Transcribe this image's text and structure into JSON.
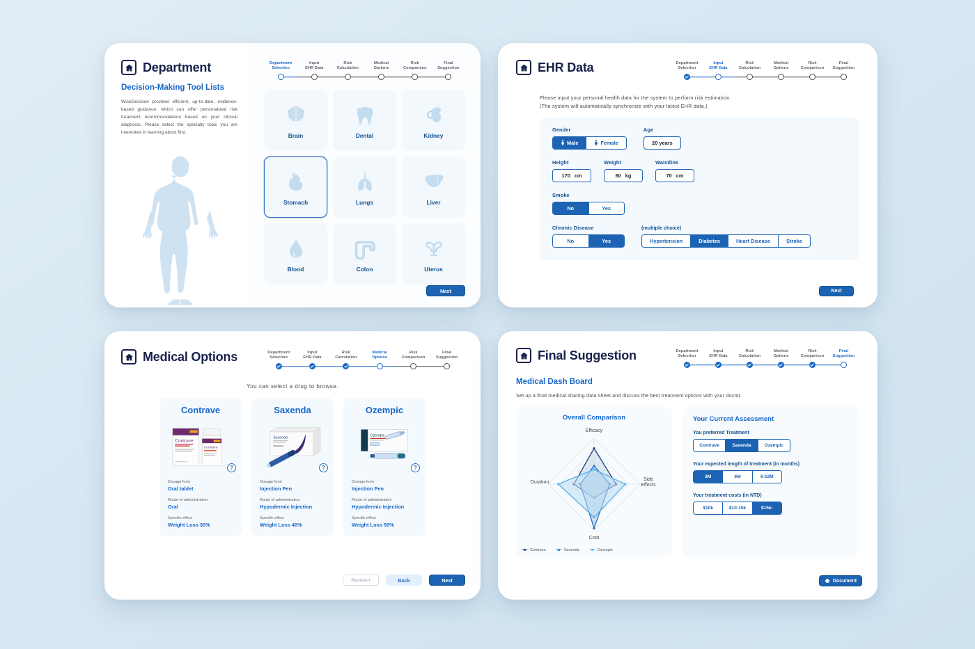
{
  "steps": [
    "Department\nSelection",
    "Input\nEHR Data",
    "Risk\nCalculation",
    "Medical\nOptions",
    "Risk\nComparison",
    "Final\nSuggestion"
  ],
  "department": {
    "title": "Department",
    "subtitle": "Decision-Making Tool Lists",
    "body": "WiseDecision provides efficient, up-to-date, evidence-based guidance, which can offer personalized risk treatment recommendations based on your clinical diagnosis. Please select the specialty topic you are interested in learning about first.",
    "organs": [
      {
        "label": "Brain",
        "icon": "brain-icon",
        "selected": false
      },
      {
        "label": "Dental",
        "icon": "tooth-icon",
        "selected": false
      },
      {
        "label": "Kidney",
        "icon": "kidney-icon",
        "selected": false
      },
      {
        "label": "Stomach",
        "icon": "stomach-icon",
        "selected": true
      },
      {
        "label": "Lungs",
        "icon": "lungs-icon",
        "selected": false
      },
      {
        "label": "Liver",
        "icon": "liver-icon",
        "selected": false
      },
      {
        "label": "Blood",
        "icon": "blood-drop-icon",
        "selected": false
      },
      {
        "label": "Colon",
        "icon": "colon-icon",
        "selected": false
      },
      {
        "label": "Uterus",
        "icon": "uterus-icon",
        "selected": false
      }
    ],
    "next_label": "Next"
  },
  "ehr": {
    "title": "EHR Data",
    "intro_line1": "Please input your personal health data for the system to perform risk estimation.",
    "intro_line2": "(The system will automatically synchronize with your latest EHR data.)",
    "gender_label": "Gender",
    "gender_options": [
      "Male",
      "Female"
    ],
    "gender_selected": "Male",
    "age_label": "Age",
    "age_value": "20 years",
    "height_label": "Height",
    "height_value": "170",
    "height_unit": "cm",
    "weight_label": "Weight",
    "weight_value": "60",
    "weight_unit": "kg",
    "waistline_label": "Waistline",
    "waistline_value": "70",
    "waistline_unit": "cm",
    "smoke_label": "Smoke",
    "smoke_options": [
      "No",
      "Yes"
    ],
    "smoke_selected": "No",
    "chronic_label": "Chronic Disease",
    "chronic_options": [
      "No",
      "Yes"
    ],
    "chronic_selected": "Yes",
    "multi_hint": "(multiple choice)",
    "conditions": [
      "Hypertension",
      "Diabetes",
      "Heart Disease",
      "Stroke"
    ],
    "conditions_selected": [
      "Diabetes"
    ],
    "next_label": "Next"
  },
  "medical_options": {
    "title": "Medical Options",
    "caption": "You can select a drug to browse.",
    "help_badge": "?",
    "keys": {
      "dosage": "Dosage form",
      "route": "Route of administration",
      "effect": "Specific effect"
    },
    "drugs": [
      {
        "name": "Contrave",
        "dosage": "Oral tablet",
        "route": "Oral",
        "effect": "Weight Loss 30%",
        "image": "contrave-box-and-bottle"
      },
      {
        "name": "Saxenda",
        "dosage": "Injection Pen",
        "route": "Hypodermic Injection",
        "effect": "Weight Loss 40%",
        "image": "saxenda-box-and-pen"
      },
      {
        "name": "Ozempic",
        "dosage": "Injection Pen",
        "route": "Hypodermic Injection",
        "effect": "Weight Loss 50%",
        "image": "ozempic-box-and-pen"
      }
    ],
    "reselect_label": "Reselect",
    "back_label": "Back",
    "next_label": "Next"
  },
  "final": {
    "title": "Final Suggestion",
    "subtitle": "Medical Dash Board",
    "body": "Set up a final medical sharing data sheet and discuss the best treatment options with your doctor.",
    "assessment_title": "Your Current Assessment",
    "pref_label": "You preferred Treatment",
    "pref_options": [
      "Contrave",
      "Saxenda",
      "Ozempic"
    ],
    "pref_selected": "Saxenda",
    "length_label": "Your expected length of treatment (in months)",
    "length_options": [
      "3M",
      "6M",
      "6-12M"
    ],
    "length_selected": "3M",
    "cost_label": "Your treatment costs (in NTD)",
    "cost_options": [
      "$10k",
      "$10-15k",
      "$15k-"
    ],
    "cost_selected": "$15k-",
    "document_label": "Document"
  },
  "chart_data": {
    "type": "radar",
    "title": "Overall Comparison",
    "axes": [
      "Efficacy",
      "Side Effects",
      "Cost",
      "Duration"
    ],
    "max": 100,
    "rings": [
      25,
      50,
      75,
      100
    ],
    "grid": true,
    "legend_position": "bottom-left",
    "series": [
      {
        "name": "Contrave",
        "color": "#1b3f7a",
        "fill": "#c9d9ea",
        "values": {
          "Efficacy": 78,
          "Side Effects": 48,
          "Cost": 30,
          "Duration": 44
        }
      },
      {
        "name": "Saxenda",
        "color": "#1f6fbe",
        "fill": "#a9c9e6",
        "values": {
          "Efficacy": 40,
          "Side Effects": 34,
          "Cost": 96,
          "Duration": 30
        }
      },
      {
        "name": "Ozempic",
        "color": "#57b0e8",
        "fill": "#bcdcf2",
        "values": {
          "Efficacy": 32,
          "Side Effects": 68,
          "Cost": 72,
          "Duration": 78
        }
      }
    ]
  }
}
